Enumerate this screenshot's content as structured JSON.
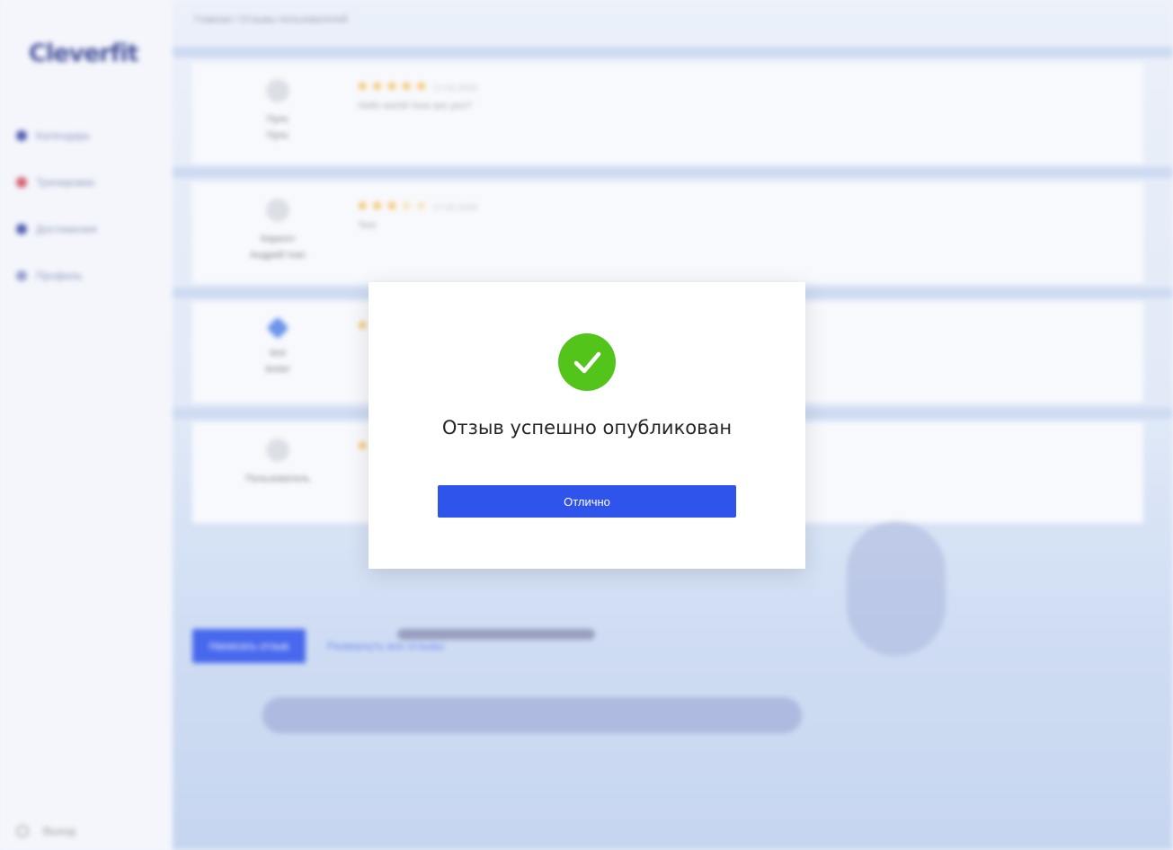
{
  "app": {
    "logo": "Cleverfit",
    "breadcrumb": "Главная / Отзывы пользователей"
  },
  "sidebar": {
    "items": [
      {
        "label": "Календарь",
        "icon": "calendar-icon"
      },
      {
        "label": "Тренировки",
        "icon": "heart-icon"
      },
      {
        "label": "Достижения",
        "icon": "trophy-icon"
      },
      {
        "label": "Профиль",
        "icon": "profile-icon"
      }
    ],
    "logout": "Выход"
  },
  "reviews": [
    {
      "author_line1": "Пупс",
      "author_line2": "Пупс",
      "rating": 5,
      "date": "17.02.2024",
      "text": "Hello world! how are you?"
    },
    {
      "author_line1": "Кирилл",
      "author_line2": "Андрей Ivan",
      "rating": 3.5,
      "date": "17.02.2024",
      "text": "Test"
    },
    {
      "author_line1": "test",
      "author_line2": "tester",
      "rating": 1,
      "date": "",
      "text": ""
    },
    {
      "author_line1": "Пользователь",
      "author_line2": "",
      "rating": 1,
      "date": "",
      "text": ""
    }
  ],
  "actions": {
    "add_review": "Написать отзыв",
    "all_reviews": "Развернуть все отзывы"
  },
  "modal": {
    "title": "Отзыв успешно опубликован",
    "button": "Отлично",
    "icon": "check-circle-icon",
    "icon_color": "#52c41a",
    "button_color": "#2f54eb"
  }
}
